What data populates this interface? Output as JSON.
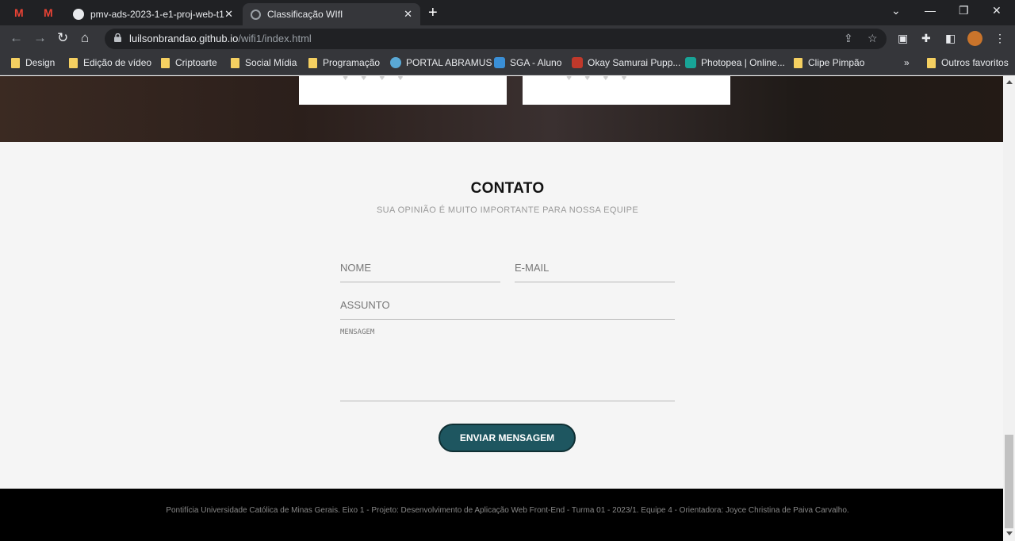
{
  "browser": {
    "tabs": [
      {
        "title": "pmv-ads-2023-1-e1-proj-web-t1"
      },
      {
        "title": "Classificação WIfI"
      }
    ],
    "url_host": "luilsonbrandao.github.io",
    "url_path": "/wifi1/index.html",
    "bookmarks": [
      "Design",
      "Edição de vídeo",
      "Criptoarte",
      "Social Mídia",
      "Programação",
      "PORTAL ABRAMUS",
      "SGA - Aluno",
      "Okay Samurai Pupp...",
      "Photopea | Online...",
      "Clipe Pimpão"
    ],
    "other_bookmarks": "Outros favoritos",
    "overflow": "»"
  },
  "contact": {
    "title": "CONTATO",
    "subtitle": "SUA OPINIÃO É MUITO IMPORTANTE PARA NOSSA EQUIPE",
    "name_placeholder": "NOME",
    "email_placeholder": "E-MAIL",
    "subject_placeholder": "ASSUNTO",
    "message_placeholder": "MENSAGEM",
    "submit": "ENVIAR MENSAGEM"
  },
  "footer": {
    "text": "Pontifícia Universidade Católica de Minas Gerais. Eixo 1 - Projeto: Desenvolvimento de Aplicação Web Front-End - Turma 01 - 2023/1. Equipe 4 - Orientadora: Joyce Christina de Paiva Carvalho."
  }
}
